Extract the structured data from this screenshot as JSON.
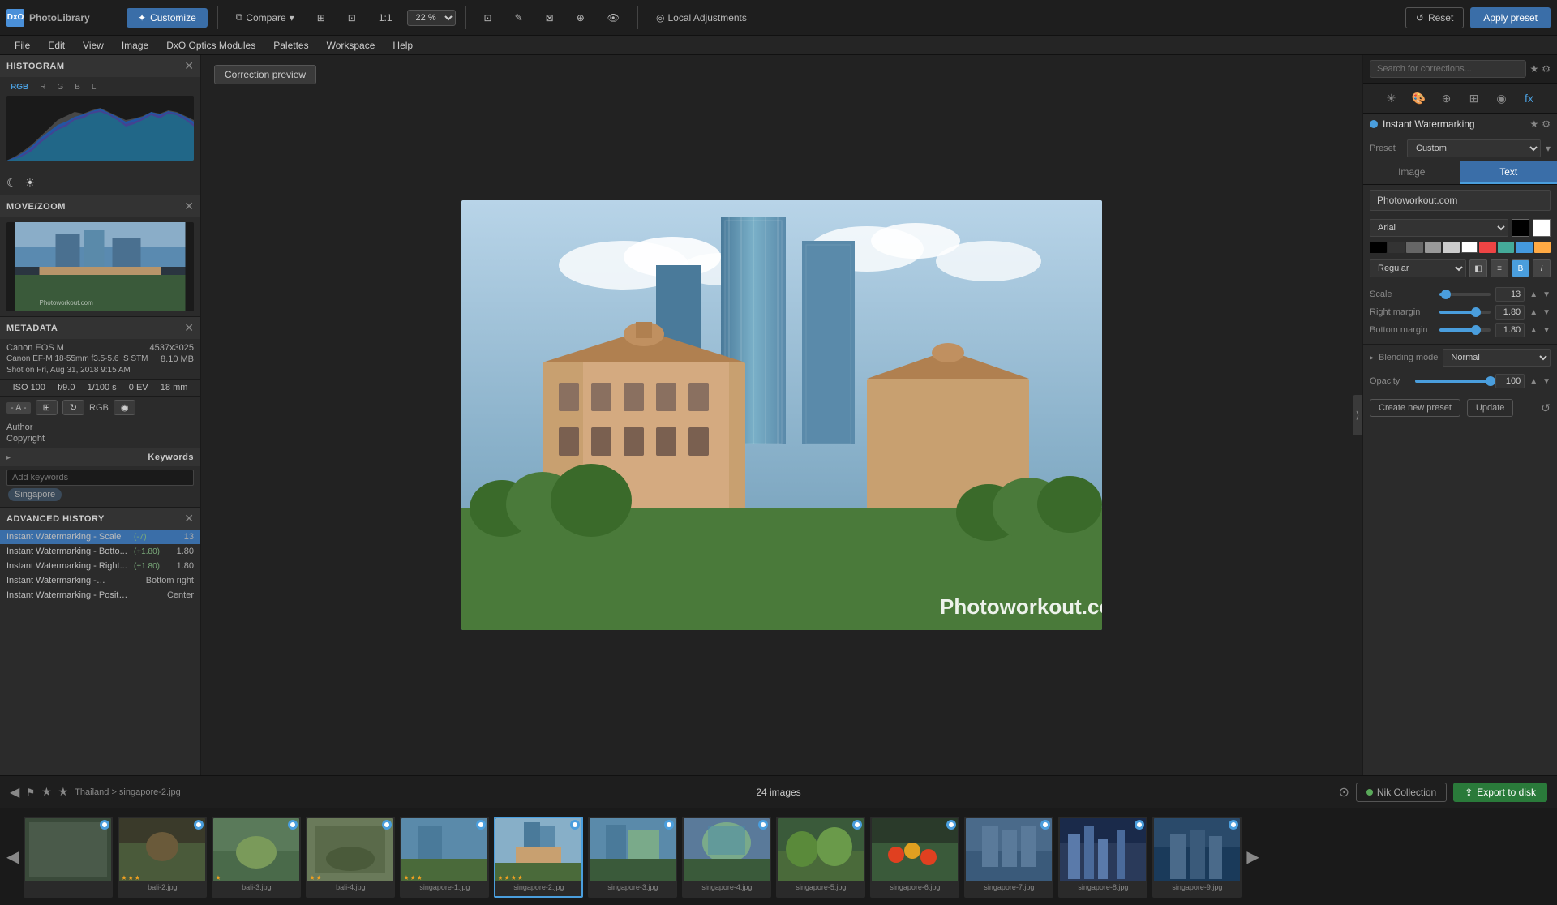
{
  "app": {
    "name": "PhotoLibrary",
    "logo_text": "DxO"
  },
  "tabs": {
    "photo_library": "PhotoLibrary",
    "customize": "Customize"
  },
  "menubar": {
    "items": [
      "File",
      "Edit",
      "View",
      "Image",
      "DxO Optics Modules",
      "Palettes",
      "Workspace",
      "Help"
    ]
  },
  "toolbar": {
    "compare_label": "Compare",
    "zoom_value": "22 %",
    "local_adjustments_label": "Local Adjustments",
    "reset_label": "Reset",
    "apply_preset_label": "Apply preset"
  },
  "correction_preview": {
    "label": "Correction preview"
  },
  "left_panel": {
    "histogram": {
      "title": "HISTOGRAM",
      "tabs": [
        "RGB",
        "R",
        "G",
        "B",
        "L"
      ]
    },
    "move_zoom": {
      "title": "MOVE/ZOOM"
    },
    "metadata": {
      "title": "METADATA",
      "camera": "Canon EOS M",
      "dimensions": "4537x3025",
      "lens": "Canon EF-M 18-55mm f3.5-5.6 IS STM",
      "file_size": "8.10 MB",
      "shot_date": "Shot on Fri, Aug 31, 2018 9:15 AM",
      "iso": "ISO 100",
      "aperture": "f/9.0",
      "shutter": "1/100 s",
      "ev": "0 EV",
      "focal": "18 mm",
      "color_space": "RGB",
      "author_label": "Author",
      "author_value": "",
      "copyright_label": "Copyright",
      "copyright_value": ""
    },
    "keywords": {
      "title": "Keywords",
      "placeholder": "Add keywords",
      "tags": [
        "Singapore"
      ]
    },
    "advanced_history": {
      "title": "ADVANCED HISTORY",
      "items": [
        {
          "label": "Instant Watermarking - Scale",
          "change": "(-7)",
          "value": "13"
        },
        {
          "label": "Instant Watermarking - Botto...",
          "change": "(+1.80)",
          "value": "1.80"
        },
        {
          "label": "Instant Watermarking - Right...",
          "change": "(+1.80)",
          "value": "1.80"
        },
        {
          "label": "Instant Watermarking - Position",
          "change": "",
          "value": "Bottom right"
        },
        {
          "label": "Instant Watermarking - Position",
          "change": "",
          "value": "Center"
        }
      ]
    }
  },
  "right_panel": {
    "search_placeholder": "Search for corrections...",
    "correction_title": "Instant Watermarking",
    "preset_label": "Preset",
    "preset_value": "Custom",
    "tabs": {
      "image": "Image",
      "text": "Text"
    },
    "text_content": "Photoworkout.com",
    "font_name": "Arial",
    "font_style": "Regular",
    "scale_label": "Scale",
    "scale_value": "13",
    "scale_percent": 13,
    "right_margin_label": "Right margin",
    "right_margin_value": "1.80",
    "right_margin_percent": 72,
    "bottom_margin_label": "Bottom margin",
    "bottom_margin_value": "1.80",
    "bottom_margin_percent": 72,
    "blending_mode_label": "Blending mode",
    "blending_mode_value": "Normal",
    "opacity_label": "Opacity",
    "opacity_value": "100",
    "opacity_percent": 100,
    "create_preset_label": "Create new preset",
    "update_label": "Update"
  },
  "watermark_text": "Photoworkout.com",
  "bottom": {
    "images_count": "24 images",
    "nik_collection_label": "Nik Collection",
    "export_label": "Export to disk"
  },
  "breadcrumb": {
    "path": "Thailand > singapore-2.jpg"
  },
  "filmstrip": {
    "items": [
      {
        "label": "bali-2.jpg",
        "active": false
      },
      {
        "label": "bali-3.jpg",
        "active": false
      },
      {
        "label": "bali-4.jpg",
        "active": false
      },
      {
        "label": "singapore-1.jpg",
        "active": false
      },
      {
        "label": "singapore-2.jpg",
        "active": true
      },
      {
        "label": "singapore-3.jpg",
        "active": false
      },
      {
        "label": "singapore-4.jpg",
        "active": false
      },
      {
        "label": "singapore-5.jpg",
        "active": false
      },
      {
        "label": "singapore-6.jpg",
        "active": false
      },
      {
        "label": "singapore-7.jpg",
        "active": false
      },
      {
        "label": "singapore-8.jpg",
        "active": false
      },
      {
        "label": "singapore-9.jpg",
        "active": false
      }
    ]
  },
  "icons": {
    "sun": "☀",
    "moon": "☾",
    "close": "✕",
    "chevron_down": "▾",
    "chevron_right": "▸",
    "search": "🔍",
    "star": "★",
    "refresh": "↺",
    "left_arrow": "◀",
    "right_arrow": "▶",
    "grid": "⊞",
    "compare": "⧉",
    "crop": "⊡",
    "zoom": "⊕",
    "hand": "✋",
    "eye": "👁",
    "flag": "⚑",
    "expand": "⟩"
  },
  "colors": {
    "accent": "#4a9edd",
    "active_tab": "#3a6ea8",
    "bg_dark": "#1e1e1e",
    "bg_panel": "#2b2b2b",
    "text_primary": "#ccc",
    "text_secondary": "#888"
  }
}
